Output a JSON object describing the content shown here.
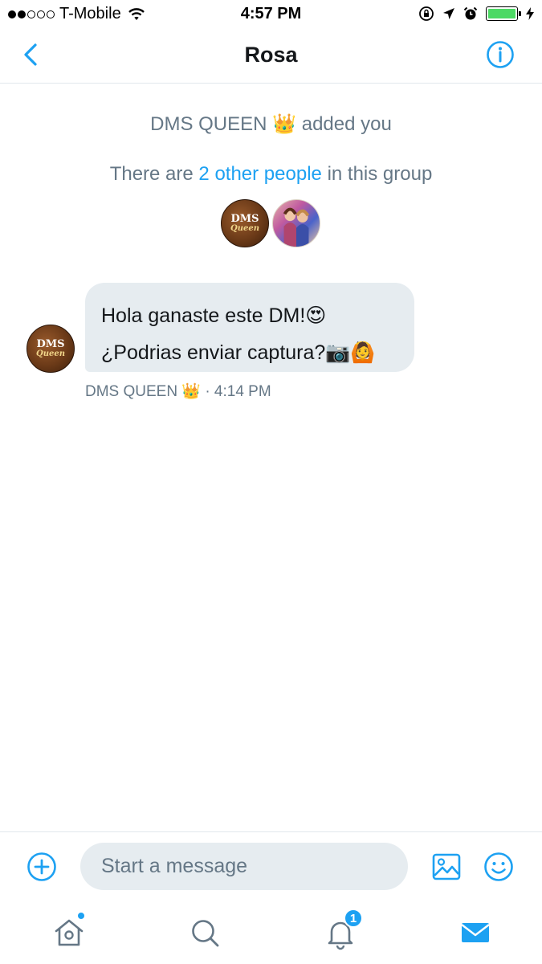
{
  "status_bar": {
    "carrier": "T-Mobile",
    "time": "4:57 PM",
    "signal_bars_filled": 2,
    "signal_bars_total": 5,
    "battery_level": 1.0
  },
  "header": {
    "title": "Rosa"
  },
  "conversation": {
    "added_notice": {
      "actor": "DMS QUEEN",
      "actor_emoji": "👑",
      "text": "added you"
    },
    "group_notice": {
      "prefix": "There are",
      "link": "2 other people",
      "suffix": "in this group"
    },
    "participants": [
      {
        "name": "DMS QUEEN",
        "avatar_text": "DMS",
        "avatar_script": "Queen"
      },
      {
        "name": "group member"
      }
    ],
    "messages": [
      {
        "line1": "Hola ganaste este DM!😍",
        "line2": "¿Podrias enviar captura?📷🙆",
        "sender": "DMS QUEEN",
        "sender_emoji": "👑",
        "time": "· 4:14 PM"
      }
    ]
  },
  "composer": {
    "placeholder": "Start a message"
  },
  "tabbar": {
    "notifications_badge": "1"
  },
  "colors": {
    "accent": "#1da1f2",
    "secondary_text": "#657786",
    "bubble": "#e6ecf0",
    "divider": "#e1e8ed"
  },
  "icons": [
    "back-chevron-icon",
    "info-icon",
    "add-icon",
    "photo-icon",
    "emoji-icon",
    "home-icon",
    "search-icon",
    "bell-icon",
    "mail-icon"
  ]
}
